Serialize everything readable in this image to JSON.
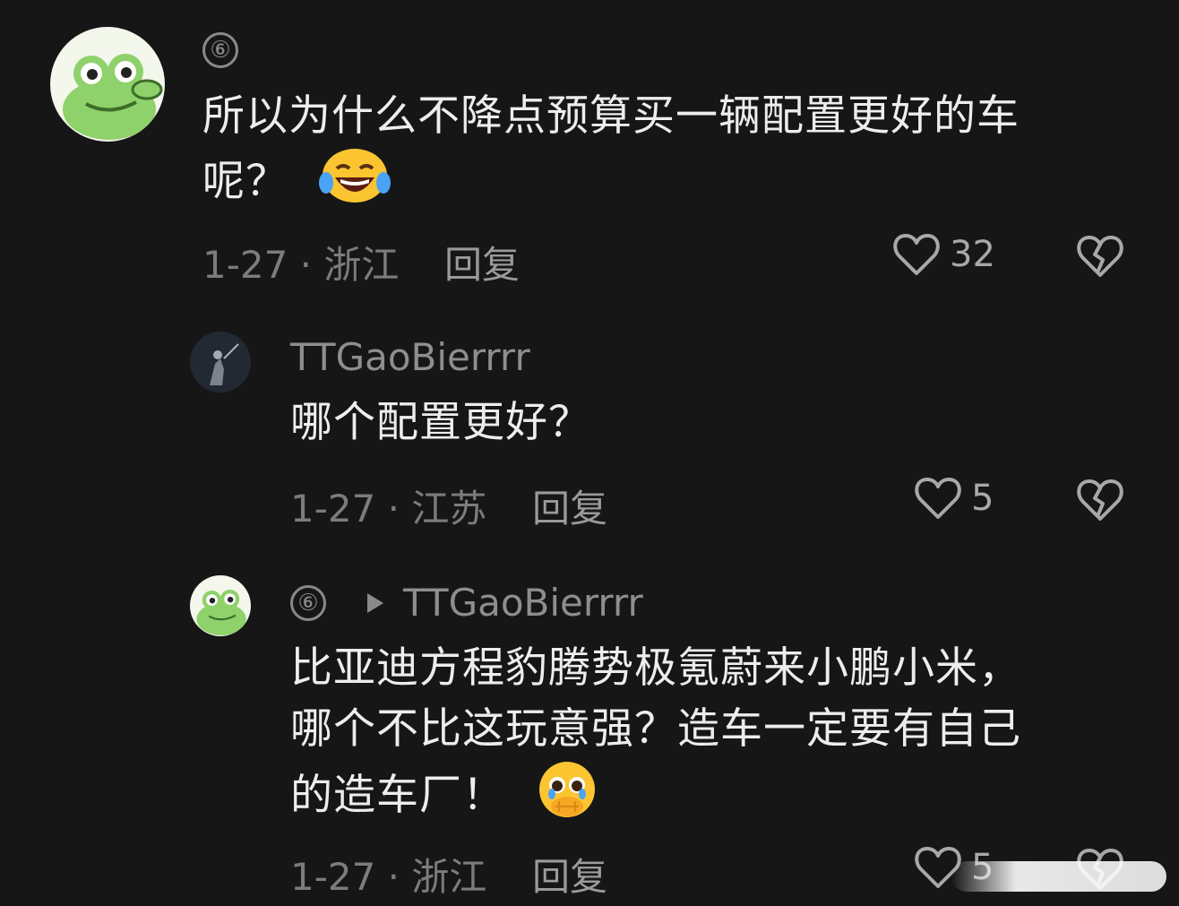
{
  "comments": [
    {
      "rank": "⑥",
      "username": "",
      "content_line1": "所以为什么不降点预算买一辆配置更好的车",
      "content_line2": "呢？",
      "emoji": "joy-tears-emoji",
      "date_location": "1-27 · 浙江",
      "reply_label": "回复",
      "like_count": "32"
    },
    {
      "username": "TTGaoBierrrr",
      "content": "哪个配置更好？",
      "date_location": "1-27 · 江苏",
      "reply_label": "回复",
      "like_count": "5"
    },
    {
      "rank": "⑥",
      "reply_to": "TTGaoBierrrr",
      "content_line1": "比亚迪方程豹腾势极氪蔚来小鹏小米，",
      "content_line2": "哪个不比这玩意强？造车一定要有自己",
      "content_line3": "的造车厂！",
      "emoji": "pleading-hands-emoji",
      "date_location": "1-27 · 浙江",
      "reply_label": "回复",
      "like_count": "5"
    }
  ],
  "colors": {
    "background": "#161616",
    "text": "#ededed",
    "muted": "#8a8a8a",
    "frog_green": "#8fd16a"
  }
}
